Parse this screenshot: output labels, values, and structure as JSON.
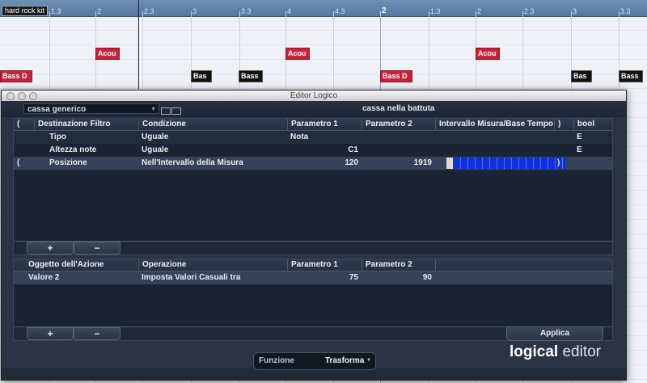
{
  "ruler": {
    "track_label": "hard rock kit",
    "ticks": [
      {
        "label": "1.3",
        "bar": false
      },
      {
        "label": "2",
        "bar": false
      },
      {
        "label": "2.3",
        "bar": false
      },
      {
        "label": "3",
        "bar": false
      },
      {
        "label": "3.3",
        "bar": false
      },
      {
        "label": "4",
        "bar": false
      },
      {
        "label": "4.3",
        "bar": false
      },
      {
        "label": "2",
        "bar": true
      },
      {
        "label": "1.3",
        "bar": false
      },
      {
        "label": "2",
        "bar": false
      },
      {
        "label": "2.3",
        "bar": false
      },
      {
        "label": "3",
        "bar": false
      },
      {
        "label": "3.3",
        "bar": false
      }
    ]
  },
  "clips": [
    {
      "label": "Acou",
      "color": "red"
    },
    {
      "label": "Acou",
      "color": "red"
    },
    {
      "label": "Acou",
      "color": "red"
    },
    {
      "label": "Bass D",
      "color": "red"
    },
    {
      "label": "Bas",
      "color": "black"
    },
    {
      "label": "Bass",
      "color": "black"
    },
    {
      "label": "Bass D",
      "color": "red"
    },
    {
      "label": "Bas",
      "color": "black"
    },
    {
      "label": "Bass",
      "color": "black"
    }
  ],
  "window": {
    "title": "Editor Logico",
    "preset_select": "cassa generico",
    "preset_name": "cassa nella battuta"
  },
  "filter": {
    "headers": {
      "paren_open": "(",
      "target": "Destinazione Filtro",
      "condition": "Condizione",
      "param1": "Parametro 1",
      "param2": "Parametro 2",
      "range": "Intervallo Misura/Base Tempo",
      "paren_close": ")",
      "bool": "bool"
    },
    "rows": [
      {
        "open": "",
        "target": "Tipo",
        "condition": "Uguale",
        "p1": "Nota",
        "p2": "",
        "close": "",
        "bool": "E"
      },
      {
        "open": "",
        "target": "Altezza note",
        "condition": "Uguale",
        "p1": "C1",
        "p2": "",
        "close": "",
        "bool": "E"
      },
      {
        "open": "(",
        "target": "Posizione",
        "condition": "Nell'Intervallo della Misura",
        "p1": "120",
        "p2": "1919",
        "close": ")",
        "bool": ""
      }
    ],
    "range_fill": 1.0,
    "add_label": "+",
    "remove_label": "−"
  },
  "action": {
    "headers": {
      "target": "Oggetto dell'Azione",
      "operation": "Operazione",
      "param1": "Parametro 1",
      "param2": "Parametro 2"
    },
    "rows": [
      {
        "target": "Valore 2",
        "operation": "Imposta Valori Casuali tra",
        "p1": "75",
        "p2": "90"
      }
    ],
    "add_label": "+",
    "remove_label": "−",
    "apply_label": "Applica"
  },
  "footer": {
    "function_label": "Funzione",
    "function_value": "Trasforma",
    "brand_bold": "logical",
    "brand_light": "editor"
  },
  "colors": {
    "clip_red": "#c5233c",
    "clip_black": "#111111",
    "range_blue": "#1030e0",
    "editor_bg": "#2b3444"
  }
}
